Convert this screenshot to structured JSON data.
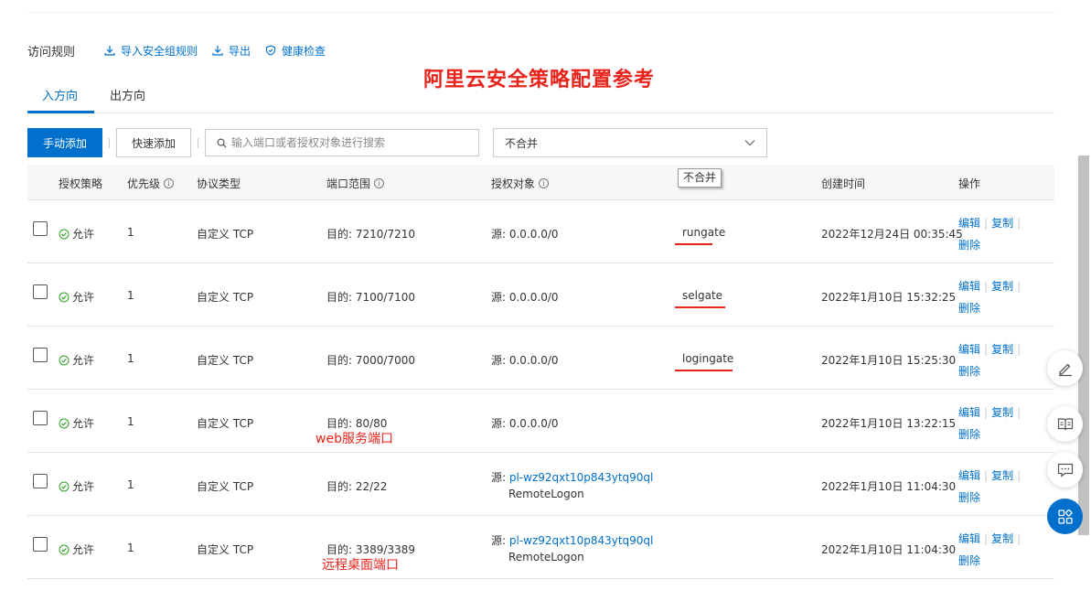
{
  "section": {
    "title": "访问规则",
    "actions": [
      {
        "label": "导入安全组规则",
        "icon": "import-icon"
      },
      {
        "label": "导出",
        "icon": "export-icon"
      },
      {
        "label": "健康检查",
        "icon": "shield-check-icon"
      }
    ]
  },
  "annotation_title": "阿里云安全策略配置参考",
  "tabs": [
    {
      "label": "入方向",
      "active": true
    },
    {
      "label": "出方向",
      "active": false
    }
  ],
  "toolbar": {
    "add_manual": "手动添加",
    "add_quick": "快速添加",
    "search_placeholder": "输入端口或者授权对象进行搜索",
    "merge_select": "不合并",
    "tooltip": "不合并"
  },
  "table": {
    "headers": [
      "授权策略",
      "优先级",
      "协议类型",
      "端口范围",
      "授权对象",
      "创建时间",
      "操作"
    ],
    "rows": [
      {
        "policy": "允许",
        "priority": "1",
        "protocol": "自定义 TCP",
        "port": "目的: 7210/7210",
        "source_prefix": "源: ",
        "source": "0.0.0.0/0",
        "source_link": false,
        "source_sub": "",
        "desc": "rungate",
        "created": "2022年12月24日 00:35:45"
      },
      {
        "policy": "允许",
        "priority": "1",
        "protocol": "自定义 TCP",
        "port": "目的: 7100/7100",
        "source_prefix": "源: ",
        "source": "0.0.0.0/0",
        "source_link": false,
        "source_sub": "",
        "desc": "selgate",
        "created": "2022年1月10日 15:32:25"
      },
      {
        "policy": "允许",
        "priority": "1",
        "protocol": "自定义 TCP",
        "port": "目的: 7000/7000",
        "source_prefix": "源: ",
        "source": "0.0.0.0/0",
        "source_link": false,
        "source_sub": "",
        "desc": "logingate",
        "created": "2022年1月10日 15:25:30"
      },
      {
        "policy": "允许",
        "priority": "1",
        "protocol": "自定义 TCP",
        "port": "目的: 80/80",
        "source_prefix": "源: ",
        "source": "0.0.0.0/0",
        "source_link": false,
        "source_sub": "",
        "desc": "",
        "created": "2022年1月10日 13:22:15"
      },
      {
        "policy": "允许",
        "priority": "1",
        "protocol": "自定义 TCP",
        "port": "目的: 22/22",
        "source_prefix": "源: ",
        "source": "pl-wz92qxt10p843ytq90ql",
        "source_link": true,
        "source_sub": "RemoteLogon",
        "desc": "",
        "created": "2022年1月10日 11:04:30"
      },
      {
        "policy": "允许",
        "priority": "1",
        "protocol": "自定义 TCP",
        "port": "目的: 3389/3389",
        "source_prefix": "源: ",
        "source": "pl-wz92qxt10p843ytq90ql",
        "source_link": true,
        "source_sub": "RemoteLogon",
        "desc": "",
        "created": "2022年1月10日 11:04:30"
      }
    ],
    "ops": {
      "edit": "编辑",
      "copy": "复制",
      "delete": "删除",
      "sep": "|"
    }
  },
  "notes": {
    "web_port": "web服务端口",
    "rdp_port": "远程桌面端口"
  },
  "float_buttons": [
    "edit-icon",
    "book-icon",
    "chat-icon",
    "apps-icon"
  ],
  "colors": {
    "accent": "#0070cc",
    "annotation": "#e8231b",
    "success": "#2ea121"
  }
}
